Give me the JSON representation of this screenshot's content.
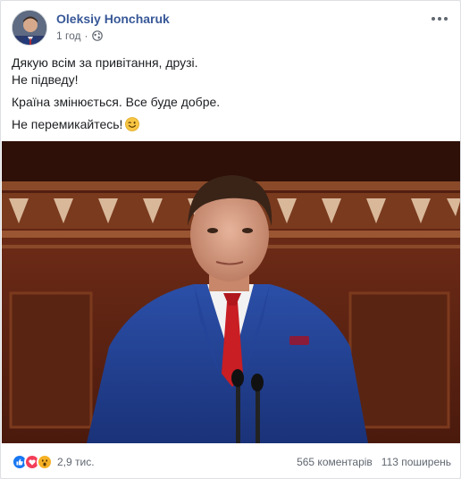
{
  "post": {
    "author": "Oleksiy Honcharuk",
    "time": "1 год",
    "separator": "·",
    "lines": [
      "Дякую всім за привітання, друзі.",
      "Не підведу!",
      "Країна змінюється. Все буде добре.",
      "Не перемикайтесь!"
    ]
  },
  "footer": {
    "reaction_count": "2,9 тис.",
    "comments": "565 коментарів",
    "shares": "113 поширень"
  },
  "icons": {
    "privacy": "globe-icon",
    "menu": "more-dots-icon",
    "emoji": "winking-face-emoji",
    "reactions": [
      "like-icon",
      "love-icon",
      "wow-icon"
    ]
  },
  "colors": {
    "link": "#385898",
    "like": "#1877f2",
    "love": "#f33e58",
    "wow": "#f7b125"
  }
}
